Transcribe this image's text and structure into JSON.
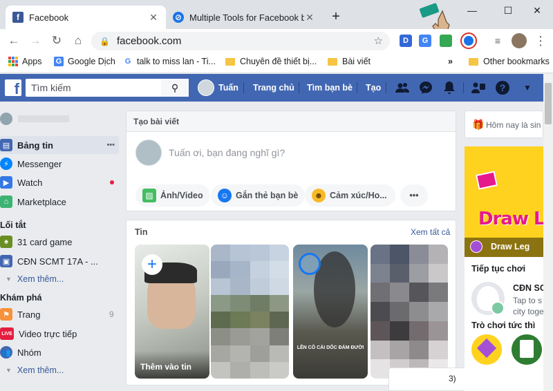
{
  "browser": {
    "tabs": [
      {
        "title": "Facebook",
        "close": "✕"
      },
      {
        "title": "Multiple Tools for Facebook by Le",
        "close": "✕"
      }
    ],
    "new_tab": "+",
    "window": {
      "minimize": "—",
      "maximize": "☐",
      "close": "✕"
    },
    "address": "facebook.com",
    "extensions": [
      "D",
      "G"
    ],
    "menu": "⋮",
    "bookmarks": {
      "apps": "Apps",
      "items": [
        "Google Dịch",
        "talk to miss lan - Ti...",
        "Chuyên đề thiết bị...",
        "Bài viết"
      ],
      "overflow": "»",
      "other": "Other bookmarks"
    }
  },
  "fb": {
    "search_placeholder": "Tìm kiếm",
    "user_name": "Tuấn",
    "nav": [
      "Trang chủ",
      "Tìm bạn bè",
      "Tạo"
    ],
    "sidebar": {
      "items": [
        {
          "label": "Bảng tin",
          "more": "•••"
        },
        {
          "label": "Messenger"
        },
        {
          "label": "Watch"
        },
        {
          "label": "Marketplace"
        }
      ],
      "shortcuts_title": "Lối tắt",
      "shortcuts": [
        "31 card game",
        "CĐN SCMT 17A - ..."
      ],
      "see_more": "Xem thêm...",
      "explore_title": "Khám phá",
      "explore": [
        {
          "label": "Trang",
          "count": "9"
        },
        {
          "label": "Video trực tiếp",
          "badge": "LIVE"
        },
        {
          "label": "Nhóm"
        }
      ],
      "see_more_2": "Xem thêm..."
    },
    "composer": {
      "header": "Tạo bài viết",
      "placeholder": "Tuấn ơi, bạn đang nghĩ gì?",
      "actions": [
        "Ảnh/Video",
        "Gắn thẻ bạn bè",
        "Cảm xúc/Ho..."
      ],
      "more": "•••"
    },
    "stories": {
      "title": "Tin",
      "see_all": "Xem tất cả",
      "add_label": "Thêm vào tin",
      "add_icon": "+",
      "caption": "LÊN CÔ CÁI DỐC ĐÁM ĐƯỜI"
    },
    "right": {
      "birthday": "Hôm nay là sin",
      "game_title": "Draw Leg",
      "game_logo": "Draw Le",
      "continue_title": "Tiếp tục chơi",
      "continue_name": "CĐN SC",
      "continue_sub1": "Tap to s",
      "continue_sub2": "city toge",
      "instant_title": "Trò chơi tức thì"
    },
    "chat_count": "3)"
  },
  "colors": {
    "fb_blue": "#4267b2",
    "link": "#365899",
    "live": "#e41e3f"
  }
}
